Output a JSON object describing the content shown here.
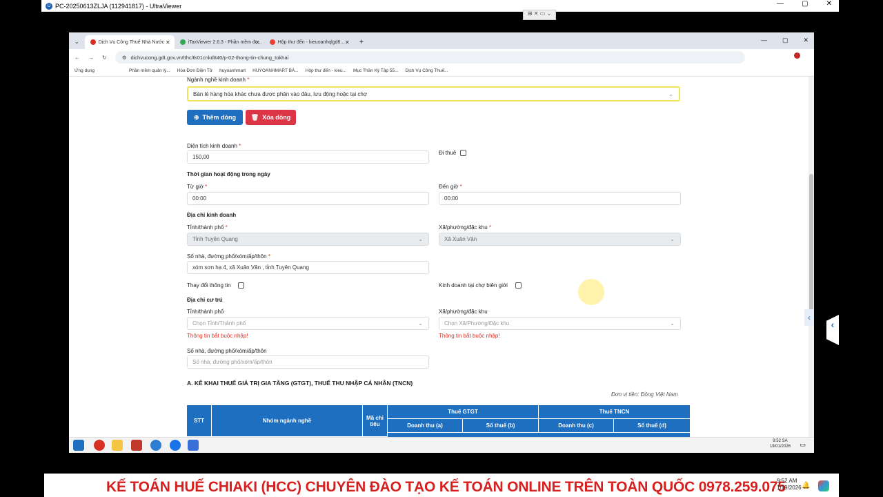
{
  "ultraviewer": {
    "title": "PC-20250613ZLJA (112941817) - UltraViewer",
    "toolbar": "⊞ ✕ ▭ ⌄"
  },
  "browser": {
    "tabs": [
      {
        "label": "Dịch Vụ Công Thuế Nhà Nước",
        "color": "#d93025"
      },
      {
        "label": "iTaxViewer 2.6.3 - Phần mềm đọ...",
        "color": "#34a853"
      },
      {
        "label": "Hộp thư đến - kieuoanhqlgd6...",
        "color": "#ea4335"
      }
    ],
    "url": "dichvucong.gdt.gov.vn/tthc/tk01cnkdtt40/p-02-thong-tin-chung_tokhai",
    "bookmarks": [
      "Ứng dụng",
      "Phần mềm quản lý...",
      "Hóa Đơn Điện Tử",
      "huyoanhmart",
      "HUYOANHMART BÁ...",
      "Hộp thư đến - kieu...",
      "Mục Thần Ký Tập 55...",
      "Dịch Vụ Công Thuế..."
    ]
  },
  "form": {
    "nganh_nghe_label": "Ngành nghề kinh doanh",
    "nganh_nghe_value": "Bán lẻ hàng hóa khác chưa được phân vào đâu, lưu động hoặc tại chợ",
    "btn_add": "Thêm dòng",
    "btn_delete": "Xóa dòng",
    "dien_tich_label": "Diện tích kinh doanh",
    "dien_tich_value": "150,00",
    "di_thue_label": "Đi thuê",
    "thoi_gian_label": "Thời gian hoạt động trong ngày",
    "tu_gio_label": "Từ giờ",
    "tu_gio_value": "00:00",
    "den_gio_label": "Đến giờ",
    "den_gio_value": "00:00",
    "dia_chi_kd_label": "Địa chỉ kinh doanh",
    "tinh_label": "Tỉnh/thành phố",
    "tinh_value": "Tỉnh Tuyên Quang",
    "xa_label": "Xã/phường/đặc khu",
    "xa_value": "Xã Xuân Vân",
    "so_nha_label": "Số nhà, đường phố/xóm/ấp/thôn",
    "so_nha_value": "xóm sơn hạ 4, xã Xuân Vân , tỉnh Tuyên Quang",
    "thay_doi_label": "Thay đổi thông tin",
    "cho_bien_gioi_label": "Kinh doanh tại chợ biên giới",
    "dia_chi_cu_tru_label": "Địa chỉ cư trú",
    "ct_tinh_label": "Tỉnh/thành phố",
    "ct_tinh_placeholder": "Chọn Tỉnh/Thành phố",
    "ct_xa_label": "Xã/phường/đặc khu",
    "ct_xa_placeholder": "Chọn Xã/Phường/Đặc khu",
    "error_required": "Thông tin bắt buộc nhập!",
    "ct_so_nha_label": "Số nhà, đường phố/xóm/ấp/thôn",
    "ct_so_nha_placeholder": "Số nhà, đường phố/xóm/ấp/thôn",
    "section_a": "A. KÊ KHAI THUẾ GIÁ TRỊ GIA TĂNG (GTGT), THUẾ THU NHẬP CÁ NHÂN (TNCN)",
    "don_vi": "Đơn vị tiền: Đồng Việt Nam"
  },
  "table": {
    "stt": "STT",
    "nhom": "Nhóm ngành nghề",
    "ma_chi_tieu": "Mã chỉ tiêu",
    "thue_gtgt": "Thuế GTGT",
    "thue_tncn": "Thuế TNCN",
    "doanh_thu_a": "Doanh thu (a)",
    "so_thue_b": "Số thuế (b)",
    "doanh_thu_c": "Doanh thu (c)",
    "so_thue_d": "Số thuế (d)"
  },
  "taskbar": {
    "time": "9:52 SA",
    "date": "19/01/2026"
  },
  "banner": {
    "text": "KẾ TOÁN HUẾ CHIAKI (HCC) CHUYÊN ĐÀO TẠO KẾ TOÁN ONLINE TRÊN TOÀN QUỐC 0978.259.075"
  },
  "local_clock": {
    "time": "9:52 AM",
    "date": "1/19/2026"
  }
}
